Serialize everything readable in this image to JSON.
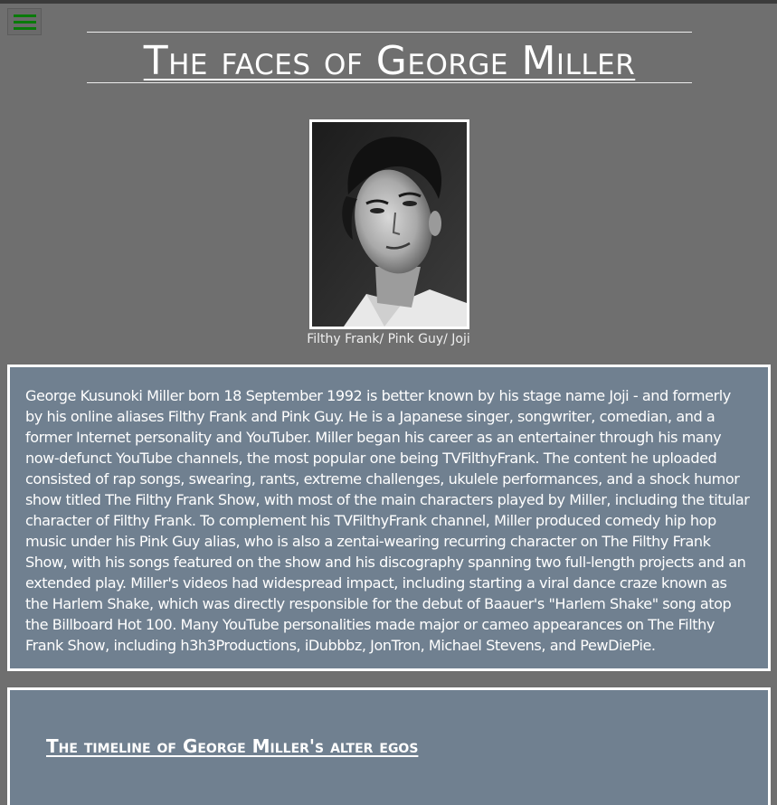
{
  "header": {
    "menu_icon": "hamburger-menu-icon",
    "title": "The faces of George Miller"
  },
  "portrait": {
    "caption": "Filthy Frank/ Pink Guy/ Joji"
  },
  "bio": {
    "text": "George Kusunoki Miller born 18 September 1992 is better known by his stage name Joji - and formerly by his online aliases Filthy Frank and Pink Guy. He is a Japanese singer, songwriter, comedian, and a former Internet personality and YouTuber. Miller began his career as an entertainer through his many now-defunct YouTube channels, the most popular one being TVFilthyFrank. The content he uploaded consisted of rap songs, swearing, rants, extreme challenges, ukulele performances, and a shock humor show titled The Filthy Frank Show, with most of the main characters played by Miller, including the titular character of Filthy Frank. To complement his TVFilthyFrank channel, Miller produced comedy hip hop music under his Pink Guy alias, who is also a zentai-wearing recurring character on The Filthy Frank Show, with his songs featured on the show and his discography spanning two full-length projects and an extended play. Miller's videos had widespread impact, including starting a viral dance craze known as the Harlem Shake, which was directly responsible for the debut of Baauer's \"Harlem Shake\" song atop the Billboard Hot 100. Many YouTube personalities made major or cameo appearances on The Filthy Frank Show, including h3h3Productions, iDubbbz, JonTron, Michael Stevens, and PewDiePie."
  },
  "timeline": {
    "title": "The timeline of George Miller's alter egos"
  },
  "colors": {
    "page_background": "#6f6f6f",
    "panel_background": "#708090",
    "menu_icon_color": "#0a7a0a",
    "text": "#ffffff"
  }
}
